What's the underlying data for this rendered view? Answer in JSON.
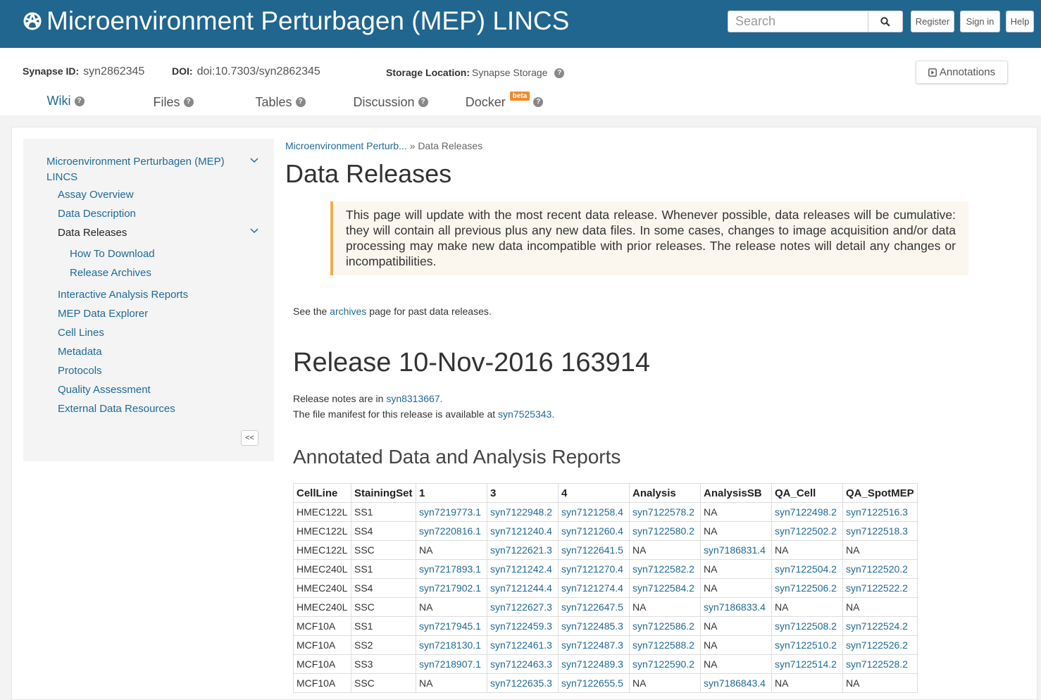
{
  "header": {
    "project_title": "Microenvironment Perturbagen (MEP) LINCS",
    "search_placeholder": "Search",
    "register_label": "Register",
    "signin_label": "Sign in",
    "help_label": "Help"
  },
  "entity": {
    "synapse_id_label": "Synapse ID:",
    "synapse_id": "syn2862345",
    "doi_label": "DOI:",
    "doi": "doi:10.7303/syn2862345",
    "storage_label": "Storage Location:",
    "storage": "Synapse Storage",
    "annotations_label": "Annotations"
  },
  "tabs": [
    {
      "label": "Wiki",
      "active": true
    },
    {
      "label": "Files"
    },
    {
      "label": "Tables"
    },
    {
      "label": "Discussion"
    },
    {
      "label": "Docker",
      "badge": "beta"
    }
  ],
  "sidebar": {
    "root_line1": "Microenvironment Perturbagen (MEP)",
    "root_line2": "LINCS",
    "items": [
      {
        "label": "Assay Overview"
      },
      {
        "label": "Data Description"
      },
      {
        "label": "Data Releases"
      },
      {
        "label": "How To Download"
      },
      {
        "label": "Release Archives"
      },
      {
        "label": "Interactive Analysis Reports"
      },
      {
        "label": "MEP Data Explorer"
      },
      {
        "label": "Cell Lines"
      },
      {
        "label": "Metadata"
      },
      {
        "label": "Protocols"
      },
      {
        "label": "Quality Assessment"
      },
      {
        "label": "External Data Resources"
      }
    ],
    "collapse_label": "<<"
  },
  "main": {
    "breadcrumb_link": "Microenvironment Perturb...",
    "breadcrumb_sep": "»",
    "breadcrumb_current": "Data Releases",
    "title": "Data Releases",
    "callout": "This page will update with the most recent data release. Whenever possible, data releases will be cumulative: they will contain all previous plus any new data files. In some cases, changes to image acquisition and/or data processing may make new data incompatible with prior releases. The release notes will detail any changes or incompatibilities.",
    "see_prefix": "See the",
    "see_link": "archives",
    "see_suffix": "page for past data releases.",
    "release_title": "Release 10-Nov-2016 163914",
    "notes_prefix": "Release notes are in",
    "notes_link": "syn8313667.",
    "manifest_prefix": "The file manifest for this release is available at",
    "manifest_link": "syn7525343.",
    "section_title": "Annotated Data and Analysis Reports"
  },
  "table": {
    "headers": [
      "CellLine",
      "StainingSet",
      "1",
      "3",
      "4",
      "Analysis",
      "AnalysisSB",
      "QA_Cell",
      "QA_SpotMEP"
    ],
    "rows": [
      [
        "HMEC122L",
        "SS1",
        "syn7219773.1",
        "syn7122948.2",
        "syn7121258.4",
        "syn7122578.2",
        "NA",
        "syn7122498.2",
        "syn7122516.3"
      ],
      [
        "HMEC122L",
        "SS4",
        "syn7220816.1",
        "syn7121240.4",
        "syn7121260.4",
        "syn7122580.2",
        "NA",
        "syn7122502.2",
        "syn7122518.3"
      ],
      [
        "HMEC122L",
        "SSC",
        "NA",
        "syn7122621.3",
        "syn7122641.5",
        "NA",
        "syn7186831.4",
        "NA",
        "NA"
      ],
      [
        "HMEC240L",
        "SS1",
        "syn7217893.1",
        "syn7121242.4",
        "syn7121270.4",
        "syn7122582.2",
        "NA",
        "syn7122504.2",
        "syn7122520.2"
      ],
      [
        "HMEC240L",
        "SS4",
        "syn7217902.1",
        "syn7121244.4",
        "syn7121274.4",
        "syn7122584.2",
        "NA",
        "syn7122506.2",
        "syn7122522.2"
      ],
      [
        "HMEC240L",
        "SSC",
        "NA",
        "syn7122627.3",
        "syn7122647.5",
        "NA",
        "syn7186833.4",
        "NA",
        "NA"
      ],
      [
        "MCF10A",
        "SS1",
        "syn7217945.1",
        "syn7122459.3",
        "syn7122485.3",
        "syn7122586.2",
        "NA",
        "syn7122508.2",
        "syn7122524.2"
      ],
      [
        "MCF10A",
        "SS2",
        "syn7218130.1",
        "syn7122461.3",
        "syn7122487.3",
        "syn7122588.2",
        "NA",
        "syn7122510.2",
        "syn7122526.2"
      ],
      [
        "MCF10A",
        "SS3",
        "syn7218907.1",
        "syn7122463.3",
        "syn7122489.3",
        "syn7122590.2",
        "NA",
        "syn7122514.2",
        "syn7122528.2"
      ],
      [
        "MCF10A",
        "SSC",
        "NA",
        "syn7122635.3",
        "syn7122655.5",
        "NA",
        "syn7186843.4",
        "NA",
        "NA"
      ]
    ]
  },
  "colors": {
    "header_bg": "#20668f",
    "link": "#1f6a96",
    "beta_badge": "#f0892b",
    "callout_border": "#f0ad4e"
  }
}
